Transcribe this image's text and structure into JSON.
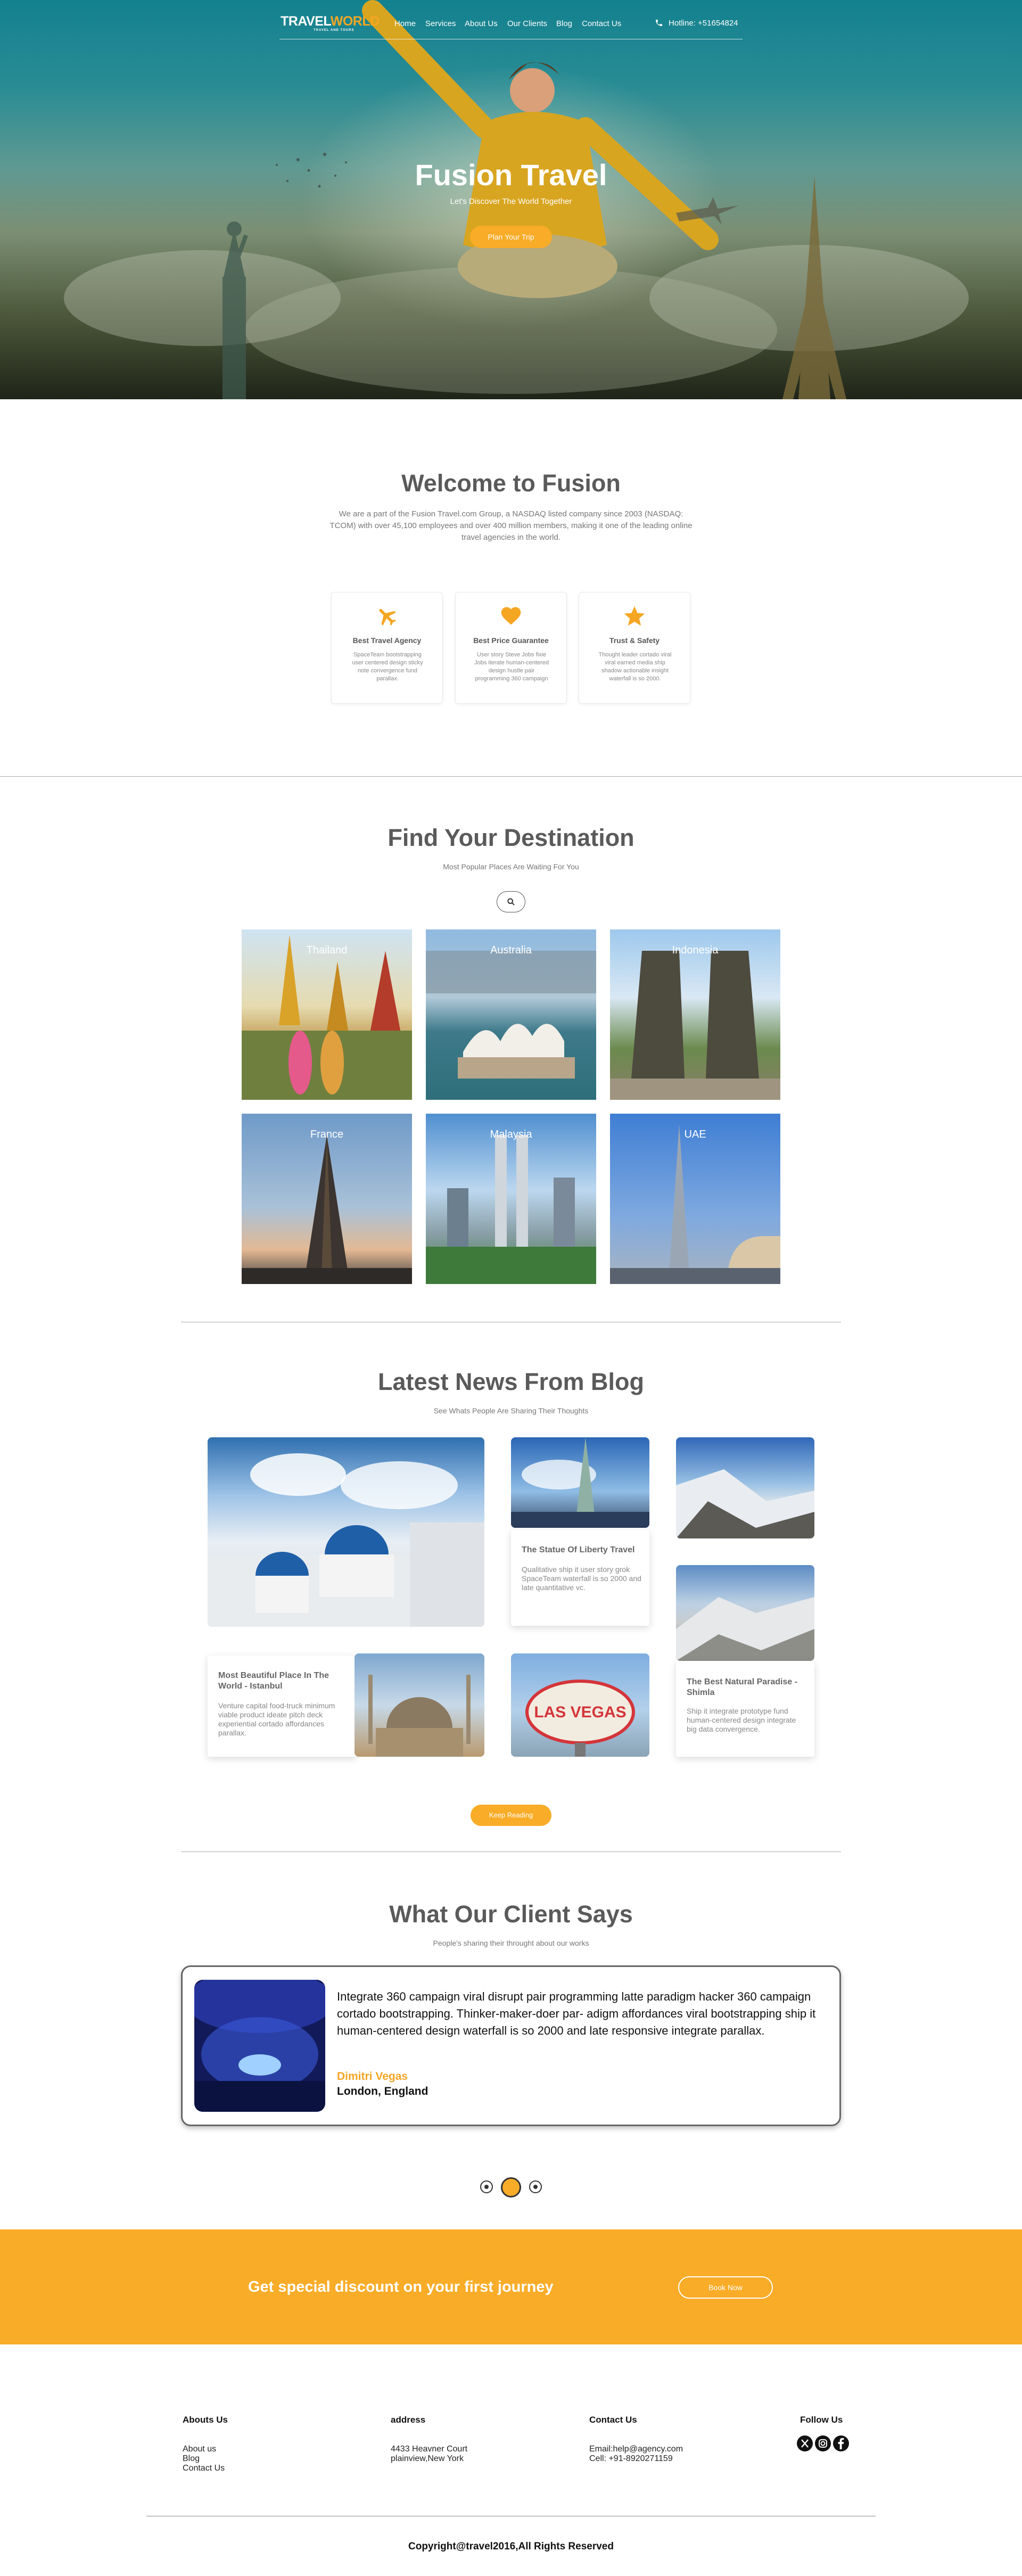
{
  "header": {
    "logo_part1": "TRAVEL",
    "logo_part2": "WORLD",
    "logo_tagline": "TRAVEL AND TOURS",
    "nav": [
      "Home",
      "Services",
      "About Us",
      "Our Clients",
      "Blog",
      "Contact Us"
    ],
    "hotline": "Hotline: +51654824"
  },
  "hero": {
    "title": "Fusion Travel",
    "subtitle": "Let's Discover The World Together",
    "button": "Plan Your Trip"
  },
  "welcome": {
    "title": "Welcome to Fusion",
    "text": "We are a part of the Fusion Travel.com Group, a NASDAQ listed company since 2003 (NASDAQ: TCOM) with over 45,100 employees and over 400 million members, making it one of the leading online travel agencies in the world.",
    "features": [
      {
        "icon": "airplane-icon",
        "title": "Best Travel Agency",
        "text": "SpaceTeam bootstrapping user centered design sticky note convergence fund parallax."
      },
      {
        "icon": "heart-icon",
        "title": "Best Price Guarantee",
        "text": "User story Steve Jobs fixie Jobs iterate human-centered design hustle pair programming 360 campaign"
      },
      {
        "icon": "star-icon",
        "title": "Trust & Safety",
        "text": "Thought leader cortado viral viral earned media ship shadow actionable insight waterfall is so 2000."
      }
    ]
  },
  "destinations": {
    "title": "Find Your Destination",
    "subtitle": "Most Popular Places Are Waiting For You",
    "items": [
      "Thailand",
      "Australia",
      "Indonesia",
      "France",
      "Malaysia",
      "UAE"
    ]
  },
  "blog": {
    "title": "Latest News From Blog",
    "subtitle": "See Whats People Are Sharing Their Thoughts",
    "posts": [
      {
        "title": "The Statue Of Liberty Travel",
        "text": "Qualitative ship it user story grok SpaceTeam waterfall is so 2000 and late quantitative vc."
      },
      {
        "title": "Most Beautiful Place In The World - Istanbul",
        "text": "Venture capital food-truck minimum viable product ideate pitch deck experiential cortado affordances parallax."
      },
      {
        "title": "The Best Natural Paradise - Shimla",
        "text": "Ship it integrate prototype fund human-centered design integrate big data convergence."
      }
    ],
    "button": "Keep Reading"
  },
  "testimonials": {
    "title": "What Our Client Says",
    "subtitle": "People's sharing their throught about our works",
    "quote": "Integrate 360 campaign viral disrupt pair programming latte paradigm hacker 360 campaign cortado bootstrapping. Thinker-maker-doer par- adigm affordances viral bootstrapping ship it human-centered design waterfall is so 2000 and late responsive integrate parallax.",
    "name": "Dimitri Vegas",
    "location": "London, England"
  },
  "promo": {
    "text": "Get special discount on your first journey",
    "button": "Book Now"
  },
  "footer": {
    "about_title": "Abouts Us",
    "about_links": [
      "About us",
      "Blog",
      "Contact Us"
    ],
    "address_title": "address",
    "address_lines": [
      "4433 Heavner Court",
      "plainview,New York"
    ],
    "contact_title": "Contact Us",
    "contact_lines": [
      "Email:help@agency.com",
      "Cell: +91-8920271159"
    ],
    "follow_title": "Follow Us",
    "social_icons": [
      "x-twitter-icon",
      "instagram-icon",
      "facebook-icon"
    ],
    "copyright": "Copyright@travel2016,All Rights Reserved"
  },
  "colors": {
    "accent": "#f9ac27",
    "hero_top": "#13818f",
    "heading": "#5a5a5a"
  }
}
